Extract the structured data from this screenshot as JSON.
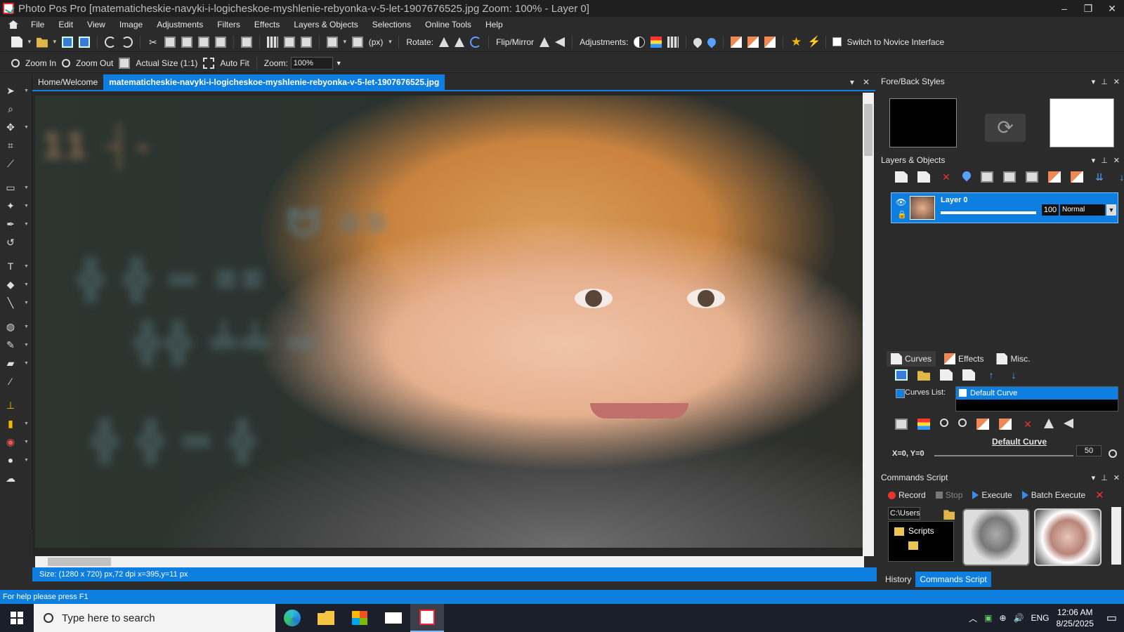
{
  "window": {
    "title": "Photo Pos Pro [matematicheskie-navyki-i-logicheskoe-myshlenie-rebyonka-v-5-let-1907676525.jpg  Zoom: 100% - Layer 0]",
    "controls": [
      "–",
      "❐",
      "✕"
    ]
  },
  "menu": [
    "File",
    "Edit",
    "View",
    "Image",
    "Adjustments",
    "Filters",
    "Effects",
    "Layers & Objects",
    "Selections",
    "Online Tools",
    "Help"
  ],
  "toolbar1": {
    "units": "(px)",
    "rotate_label": "Rotate:",
    "flip_label": "Flip/Mirror",
    "adjustments_label": "Adjustments:",
    "novice_label": "Switch to Novice Interface"
  },
  "toolbar2": {
    "zoom_in": "Zoom In",
    "zoom_out": "Zoom Out",
    "actual_size": "Actual Size (1:1)",
    "auto_fit": "Auto Fit",
    "zoom_label": "Zoom:",
    "zoom_value": "100%"
  },
  "tabs": {
    "home": "Home/Welcome",
    "document": "matematicheskie-navyki-i-logicheskoe-myshlenie-rebyonka-v-5-let-1907676525.jpg"
  },
  "canvas_status": "Size: (1280 x 720) px,72 dpi   x=395,y=11 px",
  "panels": {
    "fore_back_title": "Fore/Back Styles",
    "foreground_color": "#000000",
    "background_color": "#ffffff",
    "layers_title": "Layers & Objects",
    "layer": {
      "name": "Layer 0",
      "opacity": "100",
      "blend_mode": "Normal"
    },
    "subtabs": [
      "Curves",
      "Effects",
      "Misc."
    ],
    "curves_list_label": "Curves List:",
    "curves_item": "Default Curve",
    "curve_title": "Default Curve",
    "xy_readout": "X=0, Y=0",
    "curve_value": "50",
    "commands_title": "Commands Script",
    "record": "Record",
    "stop": "Stop",
    "execute": "Execute",
    "batch_execute": "Batch Execute",
    "path": "C:\\Users\\",
    "scripts_folder": "Scripts",
    "bottom_tabs": [
      "History",
      "Commands Script"
    ]
  },
  "help_status": "For help please press F1",
  "taskbar": {
    "search_placeholder": "Type here to search",
    "lang": "ENG",
    "time": "12:06 AM",
    "date": "8/25/2025"
  },
  "colors": {
    "accent": "#0e7fe0",
    "chrome": "#2b2b2b"
  }
}
